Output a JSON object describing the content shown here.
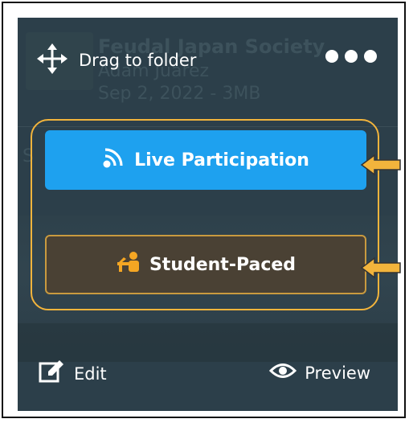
{
  "background_item": {
    "title": "Feudal Japan Society",
    "author": "Adam Juarez",
    "meta": "Sep 2, 2022 - 3MB",
    "section_letter": "S"
  },
  "top_bar": {
    "drag_label": "Drag to folder",
    "drag_icon": "move-arrows-icon",
    "menu_icon": "more-options-icon"
  },
  "modes": {
    "live_label": "Live Participation",
    "live_icon": "broadcast-icon",
    "paced_label": "Student-Paced",
    "paced_icon": "student-desk-icon"
  },
  "bottom_bar": {
    "edit_label": "Edit",
    "preview_label": "Preview"
  },
  "colors": {
    "card_bg": "#2c3f4a",
    "live_button": "#1ea1ef",
    "paced_button": "#4a4134",
    "highlight": "#f2b43c"
  }
}
